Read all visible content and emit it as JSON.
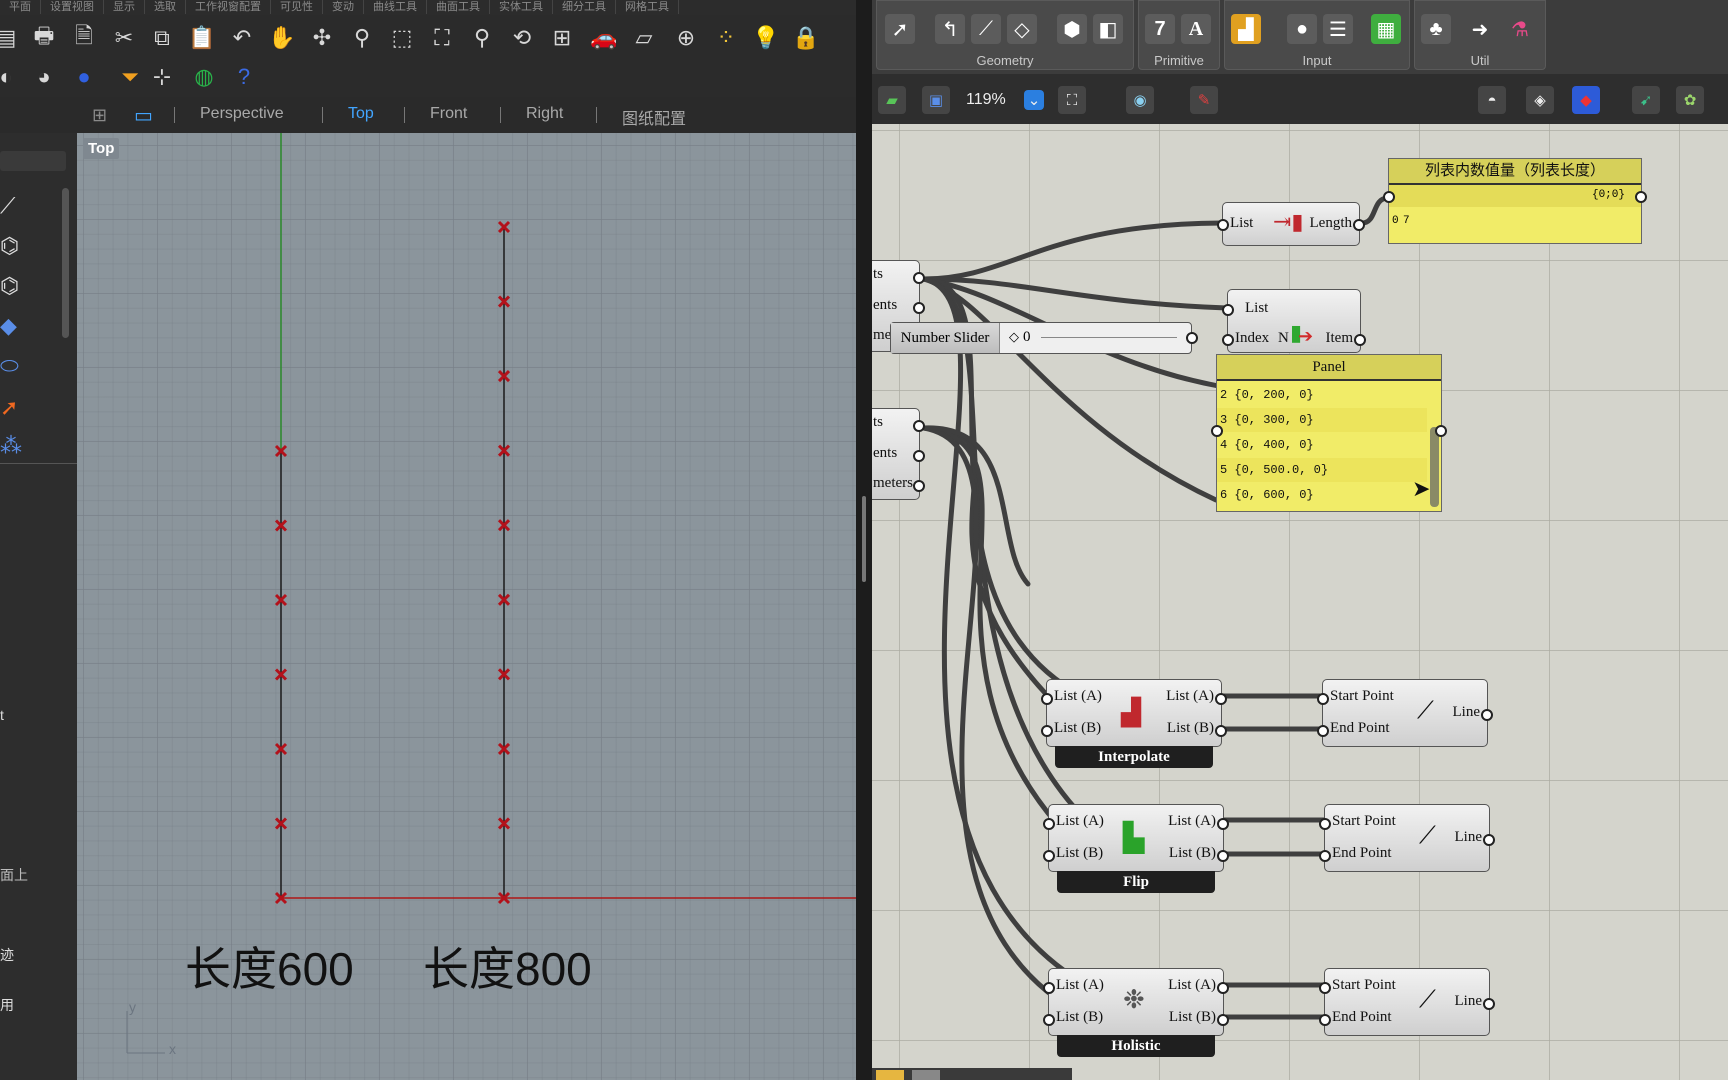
{
  "rhino": {
    "menu": [
      "平面",
      "设置视图",
      "显示",
      "选取",
      "工作视窗配置",
      "可见性",
      "变动",
      "曲线工具",
      "曲面工具",
      "实体工具",
      "细分工具",
      "网格工具"
    ],
    "viewport_tabs": [
      {
        "label": "Perspective",
        "active": false
      },
      {
        "label": "Top",
        "active": true
      },
      {
        "label": "Front",
        "active": false
      },
      {
        "label": "Right",
        "active": false
      },
      {
        "label": "图纸配置",
        "active": false
      }
    ],
    "viewport_label": "Top",
    "captions": [
      "长度600",
      "长度800"
    ],
    "axis_y": "y",
    "axis_x": "x",
    "left_panel_snippets": [
      "t",
      "面上",
      "迹",
      "用"
    ],
    "colors": {
      "point": "#b3121b",
      "x_axis": "#b01616",
      "y_axis": "#2a8a2a",
      "curve": "#1a1a1a"
    }
  },
  "gh": {
    "ribbon_groups": [
      "Geometry",
      "Primitive",
      "Input",
      "Util"
    ],
    "primitive_glyphs": [
      "7",
      "A"
    ],
    "zoom": "119%",
    "list_length": {
      "in": "List",
      "out": "Length"
    },
    "length_panel": {
      "title": "列表内数值量（列表长度）",
      "path": "{0;0}",
      "index": "0",
      "value": "7"
    },
    "list_item": {
      "in_list": "List",
      "in_index": "Index",
      "flag": "N",
      "out": "Item"
    },
    "number_slider": {
      "label": "Number Slider",
      "value": "0"
    },
    "panel": {
      "title": "Panel",
      "rows": [
        {
          "index": "2",
          "value": "{0, 200, 0}"
        },
        {
          "index": "3",
          "value": "{0, 300, 0}"
        },
        {
          "index": "4",
          "value": "{0, 400, 0}"
        },
        {
          "index": "5",
          "value": "{0, 500.0, 0}"
        },
        {
          "index": "6",
          "value": "{0, 600, 0}"
        }
      ]
    },
    "partial_params_1": [
      "ts",
      "ents",
      "me"
    ],
    "partial_params_2": [
      "ts",
      "ents",
      "meters"
    ],
    "ops": [
      {
        "name": "Interpolate",
        "in_a": "List (A)",
        "in_b": "List (B)",
        "out_a": "List (A)",
        "out_b": "List (B)"
      },
      {
        "name": "Flip",
        "in_a": "List (A)",
        "in_b": "List (B)",
        "out_a": "List (A)",
        "out_b": "List (B)"
      },
      {
        "name": "Holistic",
        "in_a": "List (A)",
        "in_b": "List (B)",
        "out_a": "List (A)",
        "out_b": "List (B)"
      }
    ],
    "line": {
      "start": "Start Point",
      "end": "End Point",
      "out": "Line"
    }
  }
}
